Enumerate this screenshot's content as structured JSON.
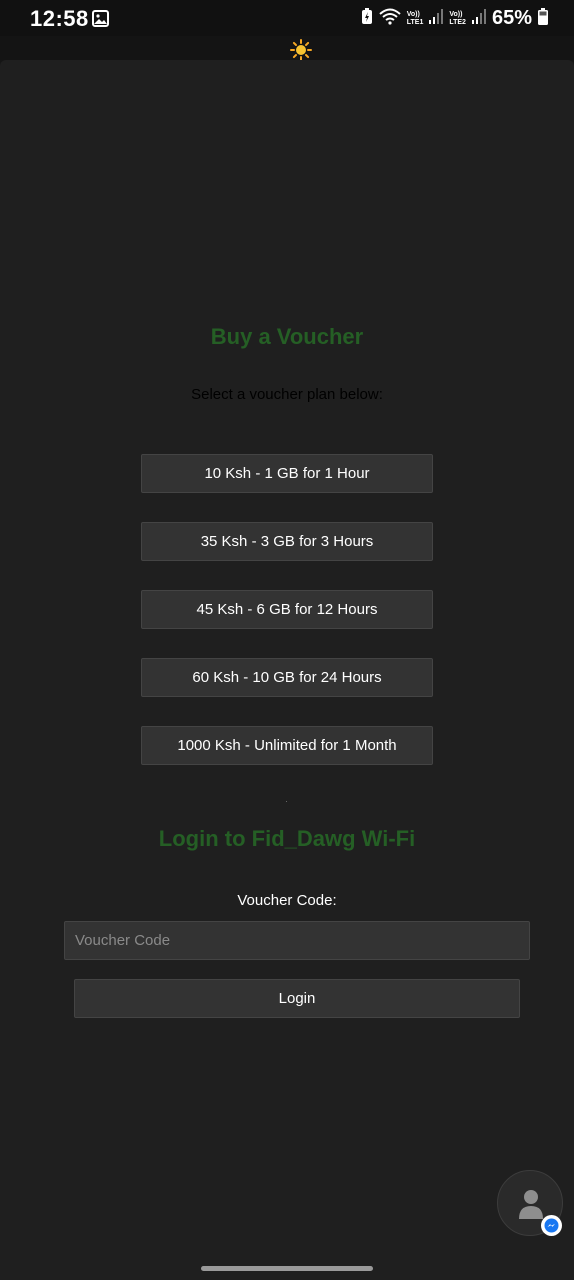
{
  "status_bar": {
    "time": "12:58",
    "sim1_label_top": "Vo))",
    "sim1_label_bottom": "LTE1",
    "sim2_label_top": "Vo))",
    "sim2_label_bottom": "LTE2",
    "battery_percent": "65%"
  },
  "voucher_section": {
    "title": "Buy a Voucher",
    "subtitle": "Select a voucher plan below:",
    "plans": [
      {
        "label": "10 Ksh - 1 GB for 1 Hour"
      },
      {
        "label": "35 Ksh - 3 GB for 3 Hours"
      },
      {
        "label": "45 Ksh - 6 GB for 12 Hours"
      },
      {
        "label": "60 Ksh - 10 GB for 24 Hours"
      },
      {
        "label": "1000 Ksh - Unlimited for 1 Month"
      }
    ]
  },
  "login_section": {
    "title": "Login to Fid_Dawg Wi-Fi",
    "voucher_label": "Voucher Code:",
    "voucher_placeholder": "Voucher Code",
    "voucher_value": "",
    "login_button": "Login"
  },
  "icons": {
    "weather": "sun-icon",
    "chat_head": "person-avatar-icon",
    "chat_badge": "messenger-icon"
  },
  "colors": {
    "page_background": "#1f1f1f",
    "heading_green": "#255f25",
    "button_background": "#333333",
    "badge_blue": "#1877f2"
  }
}
